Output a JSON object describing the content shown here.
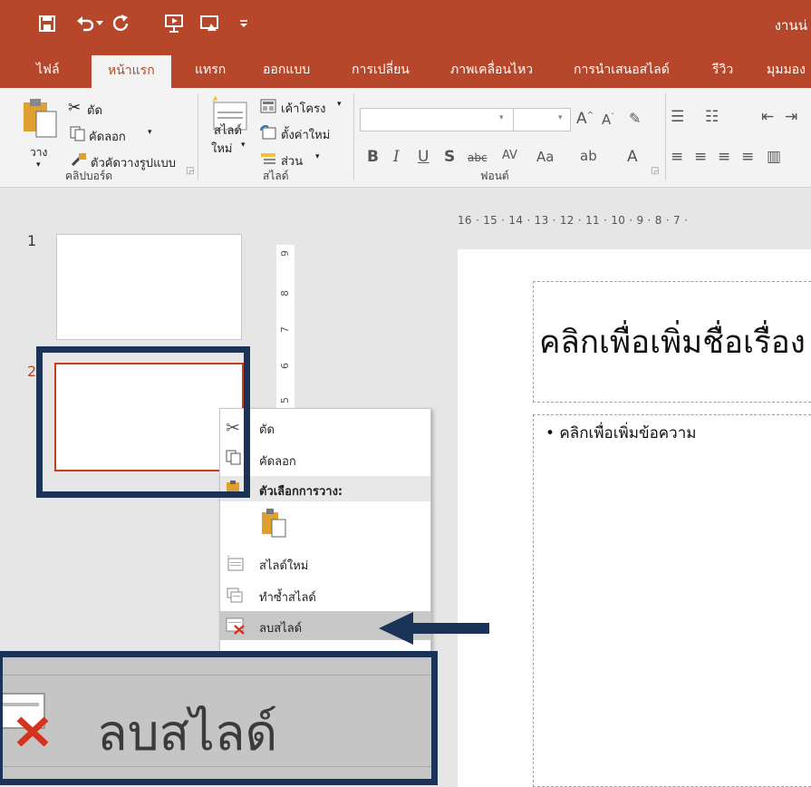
{
  "window": {
    "title": "งานน่"
  },
  "tabs": [
    {
      "label": "ไฟล์"
    },
    {
      "label": "หน้าแรก"
    },
    {
      "label": "แทรก"
    },
    {
      "label": "ออกแบบ"
    },
    {
      "label": "การเปลี่ยน"
    },
    {
      "label": "ภาพเคลื่อนไหว"
    },
    {
      "label": "การนำเสนอสไลด์"
    },
    {
      "label": "รีวิว"
    },
    {
      "label": "มุมมอง"
    }
  ],
  "ribbon": {
    "clipboard": {
      "cut": "ตัด",
      "copy": "คัดลอก",
      "format_painter": "ตัวคัดวางรูปแบบ",
      "paste": "วาง",
      "group_label": "คลิปบอร์ด"
    },
    "slides": {
      "layout": "เค้าโครง",
      "reset": "ตั้งค่าใหม่",
      "section": "ส่วน",
      "new_slide_line1": "สไลด์",
      "new_slide_line2": "ใหม่",
      "group_label": "สไลด์"
    },
    "font": {
      "group_label": "ฟอนต์"
    }
  },
  "ruler": {
    "horizontal": "16 · 15 · 14 · 13 · 12 · 11 · 10 · 9 · 8 · 7 ·",
    "vertical": [
      "9",
      "8",
      "7",
      "6",
      "5"
    ]
  },
  "thumbnails": [
    {
      "number": "1"
    },
    {
      "number": "2"
    }
  ],
  "slide": {
    "title_placeholder": "คลิกเพื่อเพิ่มชื่อเรื่อง",
    "body_placeholder": "• คลิกเพื่อเพิ่มข้อความ"
  },
  "context_menu": {
    "cut": "ตัด",
    "copy": "คัดลอก",
    "paste_options": "ตัวเลือกการวาง:",
    "new_slide": "สไลด์ใหม่",
    "duplicate": "ทำซ้ำสไลด์",
    "delete": "ลบสไลด์"
  },
  "zoom_callout": {
    "label": "ลบสไลด์"
  },
  "colors": {
    "accent": "#b7472a",
    "highlight": "#1c3358"
  }
}
